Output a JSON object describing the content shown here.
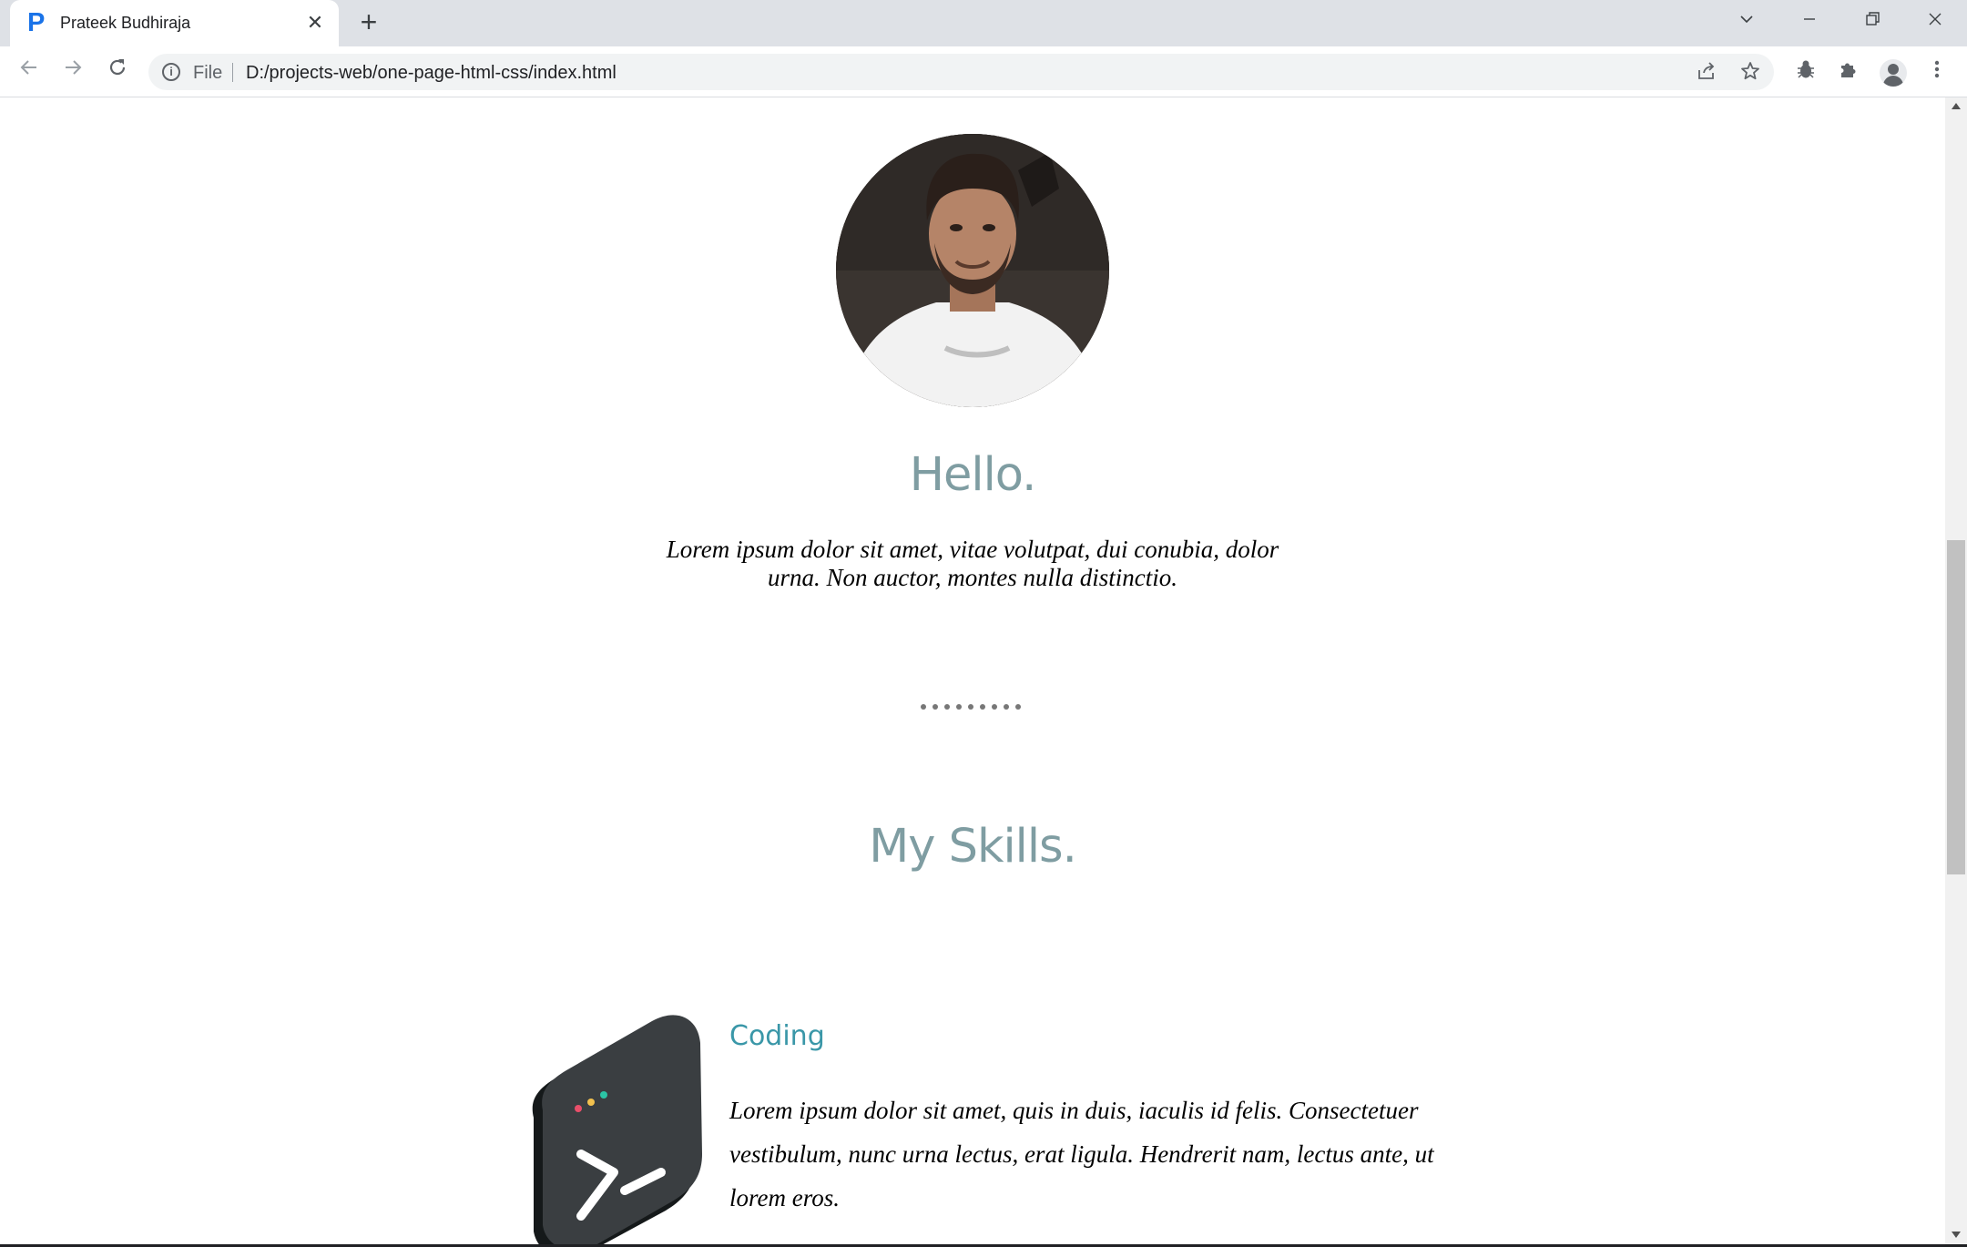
{
  "browser": {
    "tab_title": "Prateek Budhiraja",
    "tab_favicon": "P",
    "tab_close": "✕",
    "new_tab": "+",
    "file_label": "File",
    "url": "D:/projects-web/one-page-html-css/index.html"
  },
  "page": {
    "hello_heading": "Hello.",
    "hello_text": "Lorem ipsum dolor sit amet, vitae volutpat, dui conubia, dolor urna. Non auctor, montes nulla distinctio.",
    "skills_heading": "My Skills.",
    "skill": {
      "title": "Coding",
      "text": "Lorem ipsum dolor sit amet, quis in duis, iaculis id felis. Consectetuer vestibulum, nunc urna lectus, erat ligula. Hendrerit nam, lectus ante, ut lorem eros."
    }
  },
  "colors": {
    "heading": "#7f9da2",
    "skill_title": "#3a97a8",
    "favicon": "#1a73e8"
  },
  "icons": [
    "back-icon",
    "forward-icon",
    "reload-icon",
    "info-icon",
    "share-icon",
    "star-icon",
    "bug-extension-icon",
    "extensions-icon",
    "profile-icon",
    "menu-icon",
    "terminal-icon"
  ]
}
